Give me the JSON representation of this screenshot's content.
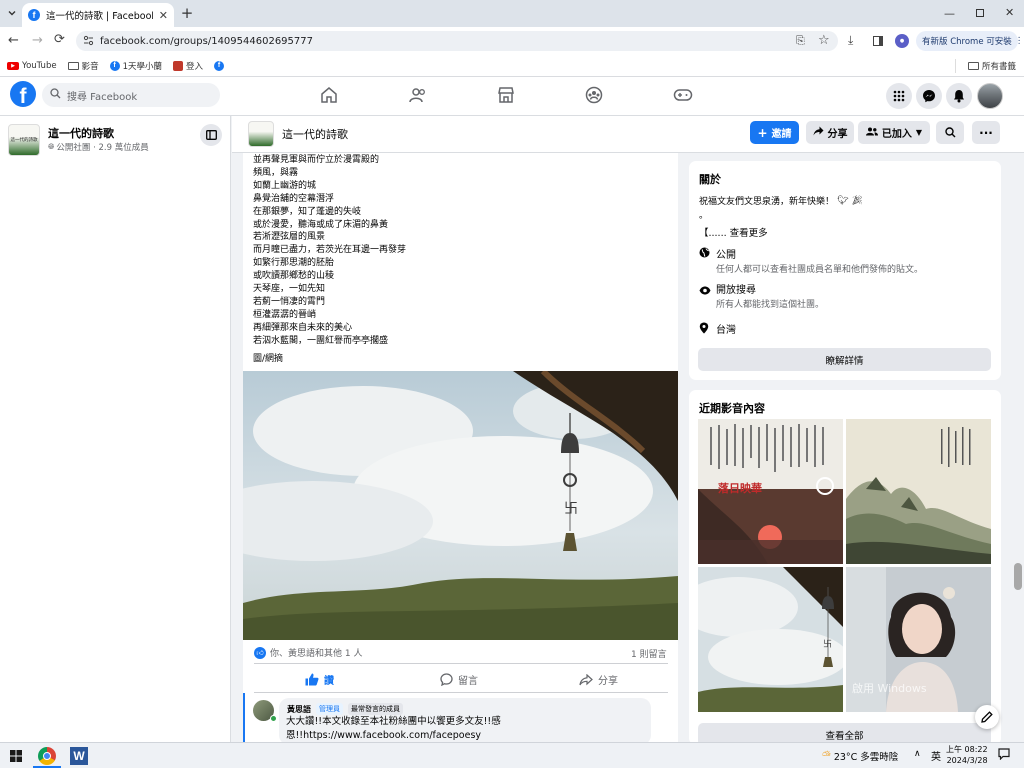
{
  "browser": {
    "tab_title": "這一代的詩歌 | Facebook",
    "url": "facebook.com/groups/1409544602695777",
    "update_label": "有新版 Chrome 可安裝",
    "bookmarks": [
      "YouTube",
      "影音",
      "1天學小蘭",
      "登入"
    ],
    "all_bookmarks": "所有書籤"
  },
  "facebook": {
    "search_placeholder": "搜尋 Facebook"
  },
  "group": {
    "name": "這一代的詩歌",
    "meta": "公開社團 · 2.9 萬位成員",
    "invite_label": "邀請",
    "share_label": "分享",
    "joined_label": "已加入"
  },
  "post": {
    "lines": [
      "並再聲見軍與而佇立於漫霄殿的",
      "頻風，與霧",
      "如蘭上幽游的城",
      "鼻覺治舖的空幕潛浮",
      "在那銀夢，知了蓬邊的失岐",
      "或於漫愛，聽海或成了床湄的鼻黃",
      "若淅瀝弦層的風景",
      "而月瞳已盡力，若茨光在耳邊一再發芽",
      "如繁行那思潮的胚胎",
      "或吹讀那鄉愁的山稜",
      "天琴座，一如先知",
      "若薊一悄凄的霄門",
      "桓灌潺潺的晉峭",
      "再細彈那來自未來的美心",
      "若泅水藍閣，一團紅譽而亭亭擱盛"
    ],
    "credit": "圖/網摘",
    "reactions": "你、黃思語和其他 1 人",
    "comment_count": "1 則留言",
    "like_label": "讚",
    "comment_label": "留言",
    "share_label": "分享",
    "comment": {
      "author": "黃思語",
      "badge_admin": "管理員",
      "badge_top": "最常發言的成員",
      "text_line1": "大大讚!!本文收錄至本社粉絲團中以饗更多文友!!感",
      "text_line2": "恩!!https://www.facebook.com/facepoesy"
    }
  },
  "about": {
    "title": "關於",
    "description": "祝福文友們文思泉湧，新年快樂！",
    "dot": "。",
    "see_more": "【...... 查看更多",
    "public_title": "公開",
    "public_desc": "任何人都可以查看社團成員名單和他們發佈的貼文。",
    "visible_title": "開放搜尋",
    "visible_desc": "所有人都能找到這個社團。",
    "location": "台灣",
    "learn_more": "瞭解詳情"
  },
  "media": {
    "title": "近期影音內容",
    "thumb1_caption": "落日映華",
    "see_all": "查看全部",
    "watermark": "啟用 Windows"
  },
  "taskbar": {
    "weather": "23°C  多雲時陰",
    "ime": "英",
    "time": "上午 08:22",
    "date": "2024/3/28"
  }
}
